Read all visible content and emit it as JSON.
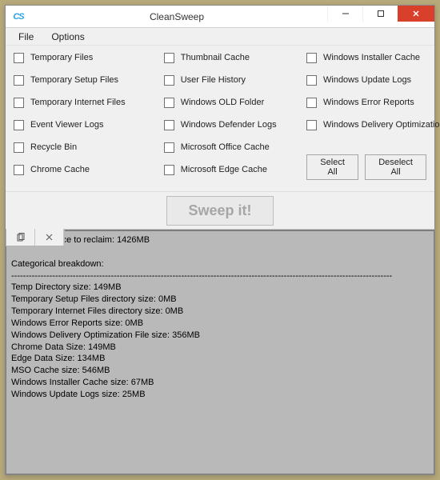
{
  "title": "CleanSweep",
  "menu": {
    "file": "File",
    "options": "Options"
  },
  "checkboxes": {
    "col1": [
      "Temporary Files",
      "Temporary Setup Files",
      "Temporary Internet Files",
      "Event Viewer Logs",
      "Recycle Bin",
      "Chrome Cache"
    ],
    "col2": [
      "Thumbnail Cache",
      "User File History",
      "Windows OLD Folder",
      "Windows Defender Logs",
      "Microsoft Office Cache",
      "Microsoft Edge Cache"
    ],
    "col3": [
      "Windows Installer Cache",
      "Windows Update Logs",
      "Windows Error Reports",
      "Windows Delivery Optimization"
    ]
  },
  "buttons": {
    "select_all": "Select All",
    "deselect_all": "Deselect All",
    "sweep": "Sweep it!"
  },
  "output_text": "Potential space to reclaim: 1426MB\n\nCategorical breakdown:\n----------------------------------------------------------------------------------------------------------------------------------\nTemp Directory size: 149MB\nTemporary Setup Files directory size: 0MB\nTemporary Internet Files directory size: 0MB\nWindows Error Reports size: 0MB\nWindows Delivery Optimization File size: 356MB\nChrome Data Size: 149MB\nEdge Data Size: 134MB\nMSO Cache size: 546MB\nWindows Installer Cache size: 67MB\nWindows Update Logs size: 25MB\n"
}
